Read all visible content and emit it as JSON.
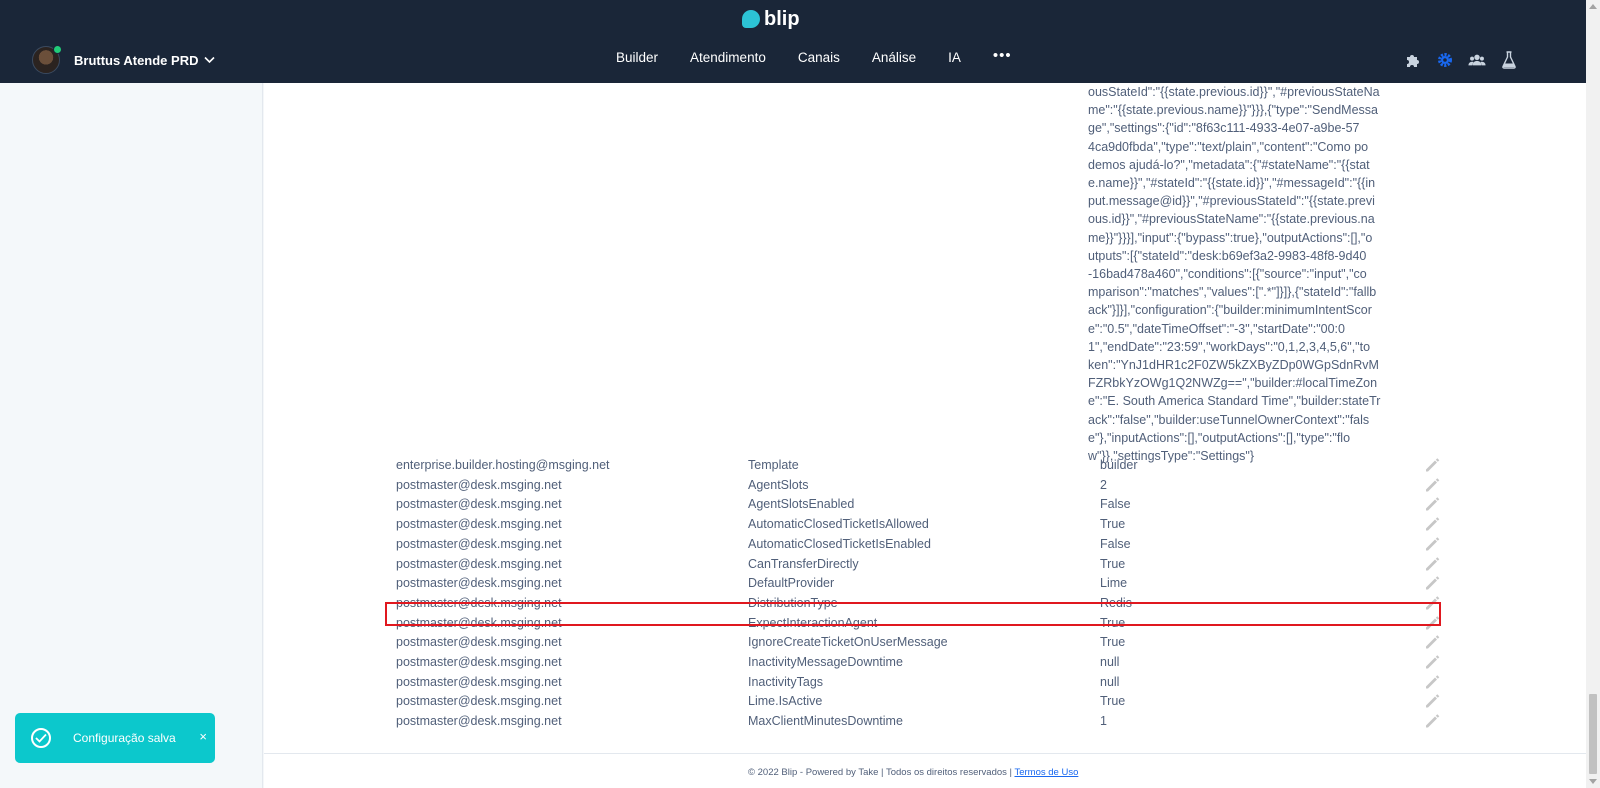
{
  "header": {
    "logo_text": "blip",
    "tenant_name": "Bruttus Atende PRD",
    "nav": [
      "Builder",
      "Atendimento",
      "Canais",
      "Análise",
      "IA"
    ],
    "more": "•••",
    "tools": [
      "puzzle-icon",
      "gear-icon",
      "team-icon",
      "flask-icon"
    ]
  },
  "json_text_lines": [
    "ousStateId\":\"{{state.previous.id}}\",\"#previousStateNa",
    "me\":\"{{state.previous.name}}\"}}},{\"type\":\"SendMessa",
    "ge\",\"settings\":{\"id\":\"8f63c111-4933-4e07-a9be-57",
    "4ca9d0fbda\",\"type\":\"text/plain\",\"content\":\"Como po",
    "demos ajudá-lo?\",\"metadata\":{\"#stateName\":\"{{stat",
    "e.name}}\",\"#stateId\":\"{{state.id}}\",\"#messageId\":\"{{in",
    "put.message@id}}\",\"#previousStateId\":\"{{state.previ",
    "ous.id}}\",\"#previousStateName\":\"{{state.previous.na",
    "me}}\"}}}],\"input\":{\"bypass\":true},\"outputActions\":[],\"o",
    "utputs\":[{\"stateId\":\"desk:b69ef3a2-9983-48f8-9d40",
    "-16bad478a460\",\"conditions\":[{\"source\":\"input\",\"co",
    "mparison\":\"matches\",\"values\":[\".*\"]}]},{\"stateId\":\"fallb",
    "ack\"}]}],\"configuration\":{\"builder:minimumIntentScor",
    "e\":\"0.5\",\"dateTimeOffset\":\"-3\",\"startDate\":\"00:0",
    "1\",\"endDate\":\"23:59\",\"workDays\":\"0,1,2,3,4,5,6\",\"to",
    "ken\":\"YnJ1dHR1c2F0ZW5kZXByZDp0WGpSdnRvM",
    "FZRbkYzOWg1Q2NWZg==\",\"builder:#localTimeZon",
    "e\":\"E. South America Standard Time\",\"builder:stateTr",
    "ack\":\"false\",\"builder:useTunnelOwnerContext\":\"fals",
    "e\"},\"inputActions\":[],\"outputActions\":[],\"type\":\"flo",
    "w\"}},\"settingsType\":\"Settings\"}"
  ],
  "rows": [
    {
      "owner": "enterprise.builder.hosting@msging.net",
      "key": "Template",
      "value": "builder"
    },
    {
      "owner": "postmaster@desk.msging.net",
      "key": "AgentSlots",
      "value": "2"
    },
    {
      "owner": "postmaster@desk.msging.net",
      "key": "AgentSlotsEnabled",
      "value": "False"
    },
    {
      "owner": "postmaster@desk.msging.net",
      "key": "AutomaticClosedTicketIsAllowed",
      "value": "True"
    },
    {
      "owner": "postmaster@desk.msging.net",
      "key": "AutomaticClosedTicketIsEnabled",
      "value": "False"
    },
    {
      "owner": "postmaster@desk.msging.net",
      "key": "CanTransferDirectly",
      "value": "True"
    },
    {
      "owner": "postmaster@desk.msging.net",
      "key": "DefaultProvider",
      "value": "Lime"
    },
    {
      "owner": "postmaster@desk.msging.net",
      "key": "DistributionType",
      "value": "Redis"
    },
    {
      "owner": "postmaster@desk.msging.net",
      "key": "ExpectInteractionAgent",
      "value": "True"
    },
    {
      "owner": "postmaster@desk.msging.net",
      "key": "IgnoreCreateTicketOnUserMessage",
      "value": "True"
    },
    {
      "owner": "postmaster@desk.msging.net",
      "key": "InactivityMessageDowntime",
      "value": "null"
    },
    {
      "owner": "postmaster@desk.msging.net",
      "key": "InactivityTags",
      "value": "null"
    },
    {
      "owner": "postmaster@desk.msging.net",
      "key": "Lime.IsActive",
      "value": "True"
    },
    {
      "owner": "postmaster@desk.msging.net",
      "key": "MaxClientMinutesDowntime",
      "value": "1"
    }
  ],
  "footer": {
    "text": "© 2022 Blip - Powered by Take | Todos os direitos reservados | ",
    "link": "Termos de Uso"
  },
  "toast": {
    "text": "Configuração salva",
    "close": "×"
  },
  "colors": {
    "header_bg": "#1a2638",
    "accent": "#2cc3d5",
    "toast_bg": "#0cc8cc",
    "highlight": "#e0181f",
    "link": "#1968f0"
  }
}
